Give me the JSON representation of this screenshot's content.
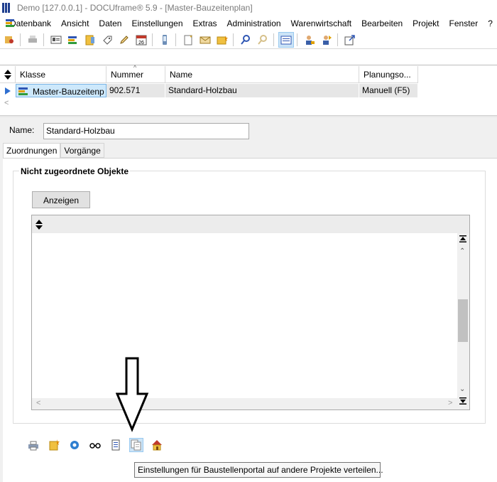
{
  "window": {
    "title": "Demo [127.0.0.1] - DOCUframe® 5.9 - [Master-Bauzeitenplan]"
  },
  "menu": {
    "items": [
      "Datenbank",
      "Ansicht",
      "Daten",
      "Einstellungen",
      "Extras",
      "Administration",
      "Warenwirtschaft",
      "Bearbeiten",
      "Projekt",
      "Fenster",
      "?"
    ]
  },
  "toolbar": {
    "icons": [
      "object-icon",
      "print-icon",
      "contact-card-icon",
      "list-icon",
      "folder-icon",
      "tag-icon",
      "pencil-icon",
      "calendar-icon",
      "phone-icon",
      "new-document-icon",
      "mail-icon",
      "folder-star-icon",
      "search-icon",
      "search-disabled-icon",
      "form-view-icon",
      "user-icon",
      "user-transfer-icon",
      "export-icon"
    ],
    "calendar_day": "26"
  },
  "grid": {
    "columns": [
      "Klasse",
      "Nummer",
      "Name",
      "Planungso..."
    ],
    "rows": [
      {
        "klasse": "Master-Bauzeitenp",
        "nummer": "902.571",
        "name": "Standard-Holzbau",
        "planung": "Manuell (F5)"
      }
    ]
  },
  "detail": {
    "name_label": "Name:",
    "name_value": "Standard-Holzbau",
    "tabs": [
      "Zuordnungen",
      "Vorgänge"
    ],
    "active_tab": "Zuordnungen",
    "group_title": "Nicht zugeordnete Objekte",
    "show_button": "Anzeigen"
  },
  "bottom_toolbar": {
    "icons": [
      "printer-icon",
      "folder-new-icon",
      "settings-icon",
      "glasses-icon",
      "document-icon",
      "copy-documents-icon",
      "home-icon"
    ],
    "hovered": "copy-documents-icon"
  },
  "tooltip": {
    "text": "Einstellungen für Baustellenportal auf andere Projekte verteilen..."
  },
  "colors": {
    "selection": "#cde8fb",
    "selection_border": "#7ab5e6",
    "panel": "#f0f0f0",
    "hover": "#cce4f7"
  }
}
